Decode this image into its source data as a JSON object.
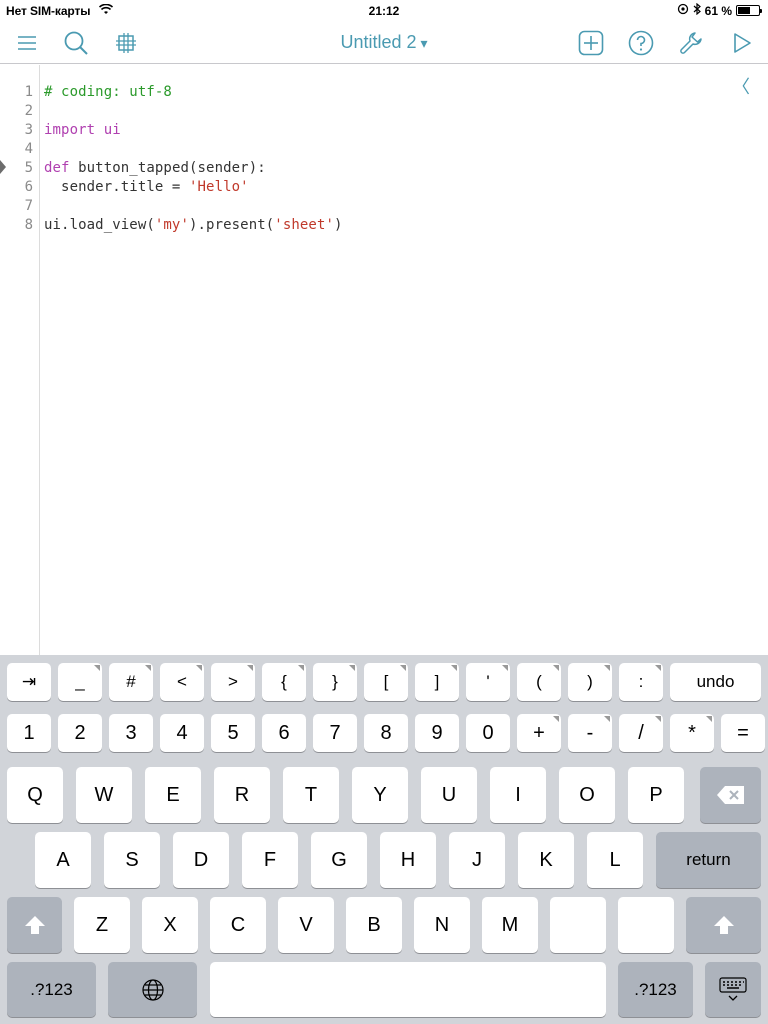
{
  "status": {
    "carrier": "Нет SIM-карты",
    "time": "21:12",
    "battery_text": "61 %",
    "battery_level": 0.61
  },
  "toolbar": {
    "title": "Untitled 2",
    "title_caret": "▾",
    "accent": "#4a9ab1",
    "icons": [
      "menu-icon",
      "search-icon",
      "grid-icon",
      "add-icon",
      "help-icon",
      "wrench-icon",
      "play-icon"
    ]
  },
  "editor": {
    "line_numbers": [
      "1",
      "2",
      "3",
      "4",
      "5",
      "6",
      "7",
      "8"
    ],
    "lines": [
      {
        "tokens": [
          {
            "t": "# coding: utf-8",
            "c": "comment"
          }
        ]
      },
      {
        "tokens": []
      },
      {
        "tokens": [
          {
            "t": "import",
            "c": "kw"
          },
          {
            "t": " "
          },
          {
            "t": "ui",
            "c": "kw"
          }
        ]
      },
      {
        "tokens": []
      },
      {
        "tokens": [
          {
            "t": "def",
            "c": "kw"
          },
          {
            "t": " button_tapped(sender):"
          }
        ]
      },
      {
        "tokens": [
          {
            "t": "  sender.title = "
          },
          {
            "t": "'Hello'",
            "c": "str"
          }
        ]
      },
      {
        "tokens": []
      },
      {
        "tokens": [
          {
            "t": "ui.load_view("
          },
          {
            "t": "'my'",
            "c": "str"
          },
          {
            "t": ").present("
          },
          {
            "t": "'sheet'",
            "c": "str"
          },
          {
            "t": ")"
          }
        ]
      }
    ],
    "collapse_chevron": "〈"
  },
  "keyboard": {
    "row_symbols": [
      "⇥",
      "_",
      "#",
      "<",
      ">",
      "{",
      "}",
      "[",
      "]",
      "'",
      "(",
      ")",
      ":",
      "undo"
    ],
    "row_numbers": [
      "1",
      "2",
      "3",
      "4",
      "5",
      "6",
      "7",
      "8",
      "9",
      "0",
      "+",
      "-",
      "/",
      "*",
      "="
    ],
    "row_q": [
      "Q",
      "W",
      "E",
      "R",
      "T",
      "Y",
      "U",
      "I",
      "O",
      "P"
    ],
    "row_a": [
      "A",
      "S",
      "D",
      "F",
      "G",
      "H",
      "J",
      "K",
      "L"
    ],
    "return_label": "return",
    "row_z": [
      "Z",
      "X",
      "C",
      "V",
      "B",
      "N",
      "M"
    ],
    "punct1_top": "!",
    "punct1_bottom": ",",
    "punct2_top": "?",
    "punct2_bottom": ".",
    "numbers_label": ".?123"
  }
}
